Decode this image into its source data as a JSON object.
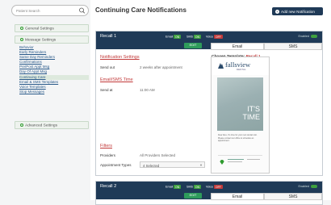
{
  "search": {
    "placeholder": "Patient Search"
  },
  "sidebar": {
    "general": "General Settings",
    "message": "Message Settings",
    "items": [
      {
        "label": "Behavior",
        "active": false
      },
      {
        "label": "Early Reminders",
        "active": false
      },
      {
        "label": "Same Day Reminders",
        "active": false
      },
      {
        "label": "Confirmations",
        "active": false
      },
      {
        "label": "Pre/Post Appt Msg",
        "active": false
      },
      {
        "label": "Day Of Appt Msg",
        "active": false
      },
      {
        "label": "Continuing Care",
        "active": true
      },
      {
        "label": "Email & SMS Templates",
        "active": false
      },
      {
        "label": "Voice Templates",
        "active": false
      },
      {
        "label": "Stop Messages",
        "active": false
      }
    ],
    "advanced": "Advanced Settings"
  },
  "header": {
    "title": "Continuing Care Notifications",
    "add_button": "Add new Notification"
  },
  "recall1": {
    "name": "Recall 1",
    "channels": {
      "email": "Email",
      "email_state": "ON",
      "sms": "SMS",
      "sms_state": "ON",
      "voice": "Voice",
      "voice_state": "OFF"
    },
    "enabled_label": "Enabled",
    "edit_button": "EDIT",
    "tabs": {
      "email": "Email",
      "sms": "SMS"
    },
    "notification_settings": "Notification Settings",
    "send_out_label": "Send out",
    "send_out_value": "2 weeks after appointment",
    "email_sms_time": "Email/SMS Time",
    "send_at_label": "Send at",
    "send_at_value": "11:00 AM",
    "filters_title": "Filters",
    "providers_label": "Providers",
    "providers_value": "All Providers Selected",
    "appointment_types_label": "Appointment Types",
    "appointment_types_value": "4 Selected",
    "chosen_template_label": "Chosen Template:",
    "chosen_template_value": "Recall 1"
  },
  "preview": {
    "logo": "fallsview",
    "logo_sub": "DENTAL",
    "headline_line1": "IT'S",
    "headline_line2": "TIME",
    "body": "Dear Alex, It's time for your next dental visit. Please contact our office to schedule an appointment."
  },
  "recall2": {
    "name": "Recall 2",
    "channels": {
      "email": "Email",
      "email_state": "ON",
      "sms": "SMS",
      "sms_state": "ON",
      "voice": "Voice",
      "voice_state": "OFF"
    },
    "enabled_label": "Enabled",
    "edit_button": "EDIT",
    "tabs": {
      "email": "Email",
      "sms": "SMS"
    }
  },
  "colors": {
    "header_bg": "#1f3a57",
    "on": "#3fa03f",
    "off": "#c23a3a",
    "accent_red": "#c23a3a",
    "link": "#2a5a8a"
  }
}
